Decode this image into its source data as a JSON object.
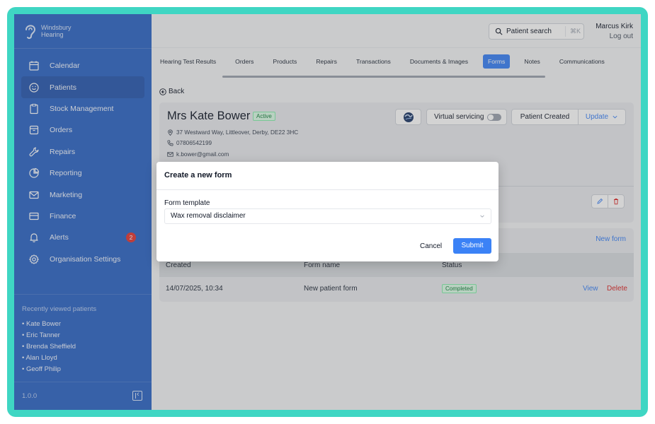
{
  "brand": {
    "line1": "Windsbury",
    "line2": "Hearing"
  },
  "sidebar": {
    "items": [
      {
        "label": "Calendar",
        "icon": "calendar-icon"
      },
      {
        "label": "Patients",
        "icon": "smiley-icon"
      },
      {
        "label": "Stock Management",
        "icon": "clipboard-icon"
      },
      {
        "label": "Orders",
        "icon": "package-icon"
      },
      {
        "label": "Repairs",
        "icon": "wrench-icon"
      },
      {
        "label": "Reporting",
        "icon": "pie-chart-icon"
      },
      {
        "label": "Marketing",
        "icon": "mail-icon"
      },
      {
        "label": "Finance",
        "icon": "card-icon"
      },
      {
        "label": "Alerts",
        "icon": "bell-icon",
        "badge": "2"
      },
      {
        "label": "Organisation Settings",
        "icon": "gear-icon"
      }
    ],
    "recent_title": "Recently viewed patients",
    "recent": [
      "• Kate Bower",
      "• Eric Tanner",
      "• Brenda Sheffield",
      "• Alan Lloyd",
      "• Geoff Philip"
    ],
    "version": "1.0.0",
    "accent": "#2f67c6"
  },
  "topbar": {
    "search_label": "Patient search",
    "shortcut": "⌘K",
    "user_name": "Marcus Kirk",
    "logout": "Log out"
  },
  "tabs": [
    "Hearing Test Results",
    "Orders",
    "Products",
    "Repairs",
    "Transactions",
    "Documents & Images",
    "Forms",
    "Notes",
    "Communications"
  ],
  "active_tab": "Forms",
  "back_label": "Back",
  "patient": {
    "name": "Mrs Kate Bower",
    "status": "Active",
    "address": "37 Westward Way, Littleover, Derby, DE22 3HC",
    "phone": "07806542199",
    "email": "k.bower@gmail.com",
    "virtual_label": "Virtual servicing",
    "created_label": "Patient Created",
    "update_label": "Update"
  },
  "forms": {
    "new_form_label": "New form",
    "columns": [
      "Created",
      "Form name",
      "Status"
    ],
    "rows": [
      {
        "created": "14/07/2025, 10:34",
        "name": "New patient form",
        "status": "Completed",
        "view": "View",
        "delete": "Delete"
      }
    ]
  },
  "modal": {
    "title": "Create a new form",
    "field_label": "Form template",
    "selected": "Wax removal disclaimer",
    "cancel": "Cancel",
    "submit": "Submit"
  }
}
